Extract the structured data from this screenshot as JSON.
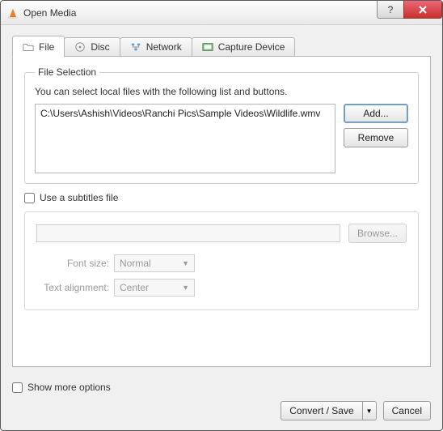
{
  "window": {
    "title": "Open Media"
  },
  "tabs": {
    "file": "File",
    "disc": "Disc",
    "network": "Network",
    "capture": "Capture Device"
  },
  "file_selection": {
    "legend": "File Selection",
    "hint": "You can select local files with the following list and buttons.",
    "files": [
      "C:\\Users\\Ashish\\Videos\\Ranchi Pics\\Sample Videos\\Wildlife.wmv"
    ],
    "add": "Add...",
    "remove": "Remove"
  },
  "subtitles": {
    "use_label": "Use a subtitles file",
    "browse": "Browse...",
    "font_size_label": "Font size:",
    "font_size_value": "Normal",
    "alignment_label": "Text alignment:",
    "alignment_value": "Center"
  },
  "footer": {
    "show_more": "Show more options",
    "convert": "Convert / Save",
    "cancel": "Cancel"
  }
}
